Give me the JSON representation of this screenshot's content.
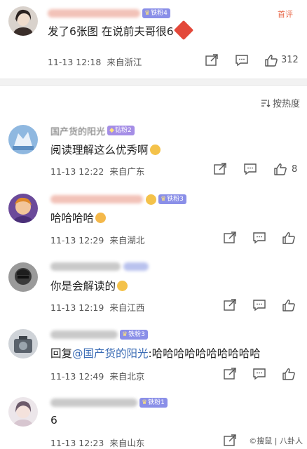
{
  "post": {
    "badge": "铁粉4",
    "author_tag": "首评",
    "content": "发了6张图  在说前夫哥很6",
    "time": "11-13 12:18",
    "location": "来自浙江",
    "like_count": "312"
  },
  "sort_label": "按热度",
  "comments": [
    {
      "name": "国产货的阳光",
      "badge": "钻粉2",
      "content": "阅读理解这么优秀啊",
      "time": "11-13 12:22",
      "location": "来自广东",
      "like_count": "8"
    },
    {
      "badge": "铁粉3",
      "content": "哈哈哈哈",
      "time": "11-13 12:29",
      "location": "来自湖北"
    },
    {
      "content": "你是会解读的",
      "time": "11-13 12:19",
      "location": "来自江西"
    },
    {
      "badge": "铁粉3",
      "reply_prefix": "回复",
      "mention": "@国产货的阳光",
      "content": ":哈哈哈哈哈哈哈哈哈哈",
      "time": "11-13 12:49",
      "location": "来自北京"
    },
    {
      "badge": "铁粉1",
      "content": "6",
      "time": "11-13 12:23",
      "location": "来自山东"
    }
  ],
  "watermark": "©搜鼠 | 八卦人",
  "colors": {
    "name_blur": "#f2c2b8",
    "accent_red": "#e8694a",
    "badge": "#8a8fe8",
    "mention": "#3b6cb5"
  }
}
